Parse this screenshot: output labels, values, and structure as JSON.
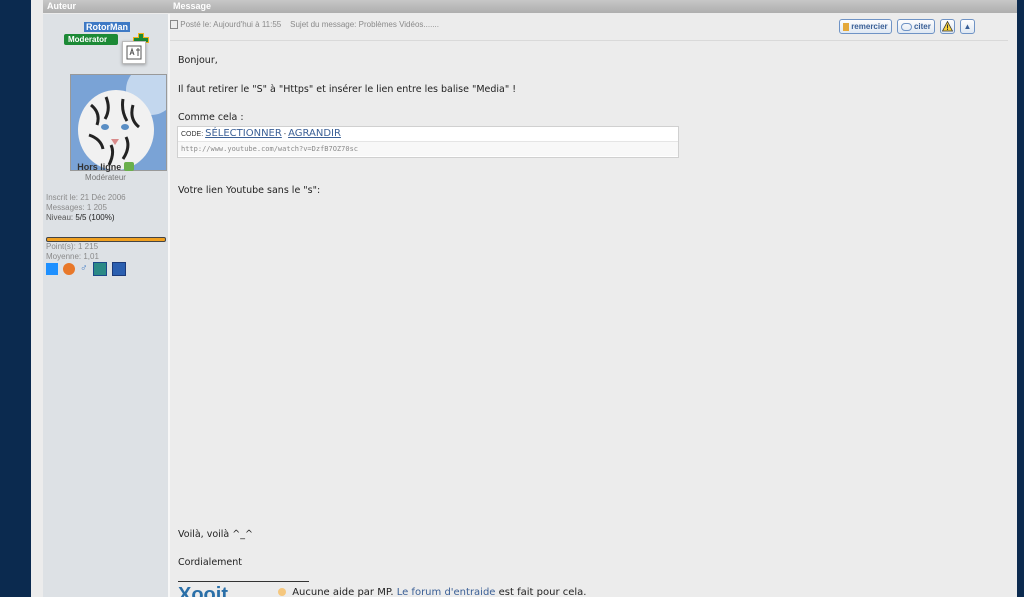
{
  "table": {
    "col_author": "Auteur",
    "col_message": "Message"
  },
  "author": {
    "username": "RotorMan",
    "badge": "Moderator",
    "status": "Hors ligne",
    "rank": "Modérateur",
    "registered": "Inscrit le: 21 Déc 2006",
    "messages": "Messages: 1 205",
    "level_label": "Niveau:",
    "level_value": "5/5 (100%)",
    "level_fraction": 1.0,
    "points": "Point(s): 1 215",
    "average": "Moyenne: 1,01",
    "icons": [
      "windows-icon",
      "firefox-icon",
      "gender-male-icon",
      "webcam-icon",
      "profile-icon"
    ]
  },
  "post": {
    "posted": "Posté le: Aujourd'hui à 11:55",
    "subject": "Sujet du message: Problèmes Vidéos.......",
    "actions": {
      "thank": "remercier",
      "quote": "citer"
    },
    "greeting": "Bonjour,",
    "paragraph1": "Il faut retirer le \"S\" à \"Https\" et insérer le lien entre les balise \"Media\" !",
    "intro_code": "Comme cela :",
    "code_label": "CODE:",
    "code_select": "SÉLECTIONNER",
    "code_sep": " - ",
    "code_expand": "AGRANDIR",
    "code_content": "http://www.youtube.com/watch?v=DzfB7OZ70sc",
    "paragraph2": "Votre lien Youtube sans le \"s\":",
    "closing1": "Voilà, voilà ^_^",
    "closing2": "Cordialement"
  },
  "signature": {
    "logo": "Xooit",
    "text_before": "Aucune aide par MP.",
    "link": "Le forum d'entraide",
    "text_after": "est fait pour cela."
  },
  "colors": {
    "outer_background": "#0b2a4f",
    "username_highlight": "#3d79c5",
    "moderator_badge": "#1c8a36",
    "level_bar": "#f0a020",
    "link": "#3a5f96"
  }
}
